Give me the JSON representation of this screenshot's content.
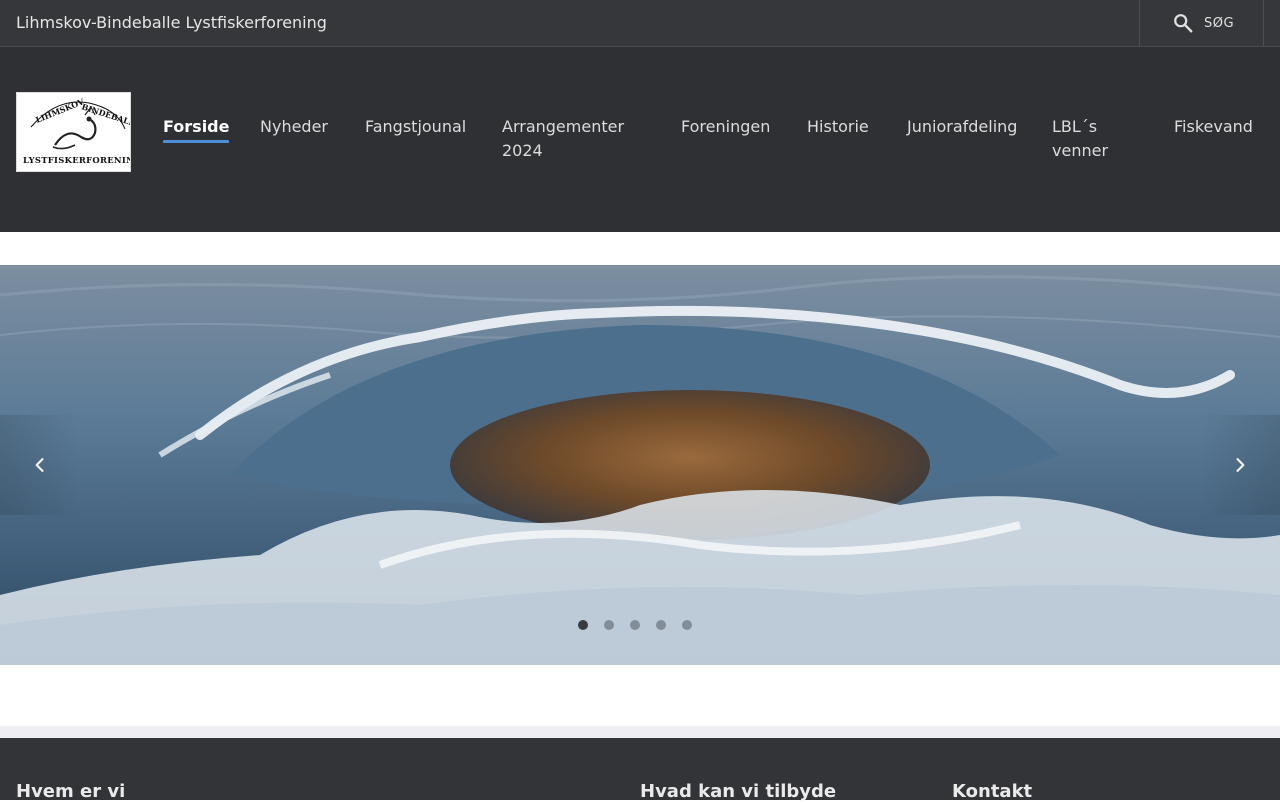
{
  "topbar": {
    "site_title": "Lihmskov-Bindeballe Lystfiskerforening",
    "search_label": "SØG",
    "search_icon": "search-icon"
  },
  "header": {
    "logo_text": "LIHMSKOV - BINDEBALLE LYSTFISKERFORENING",
    "nav": [
      {
        "label": "Forside",
        "active": true
      },
      {
        "label": "Nyheder",
        "active": false
      },
      {
        "label": "Fangstjounal",
        "active": false
      },
      {
        "label": "Arrangementer 2024",
        "active": false
      },
      {
        "label": "Foreningen",
        "active": false
      },
      {
        "label": "Historie",
        "active": false
      },
      {
        "label": "Juniorafdeling",
        "active": false
      },
      {
        "label": "LBL´s venner",
        "active": false
      },
      {
        "label": "Fiskevand",
        "active": false
      }
    ]
  },
  "hero": {
    "prev_icon": "chevron-left-icon",
    "next_icon": "chevron-right-icon",
    "slide_count": 5,
    "active_slide": 1
  },
  "footer": {
    "headings": [
      "Hvem er vi",
      "Hvad kan vi tilbyde",
      "Kontakt"
    ]
  },
  "colors": {
    "topbar_bg": "#36373b",
    "header_bg": "#2f3034",
    "accent": "#4d8fd6",
    "footer_bg": "#333438"
  }
}
